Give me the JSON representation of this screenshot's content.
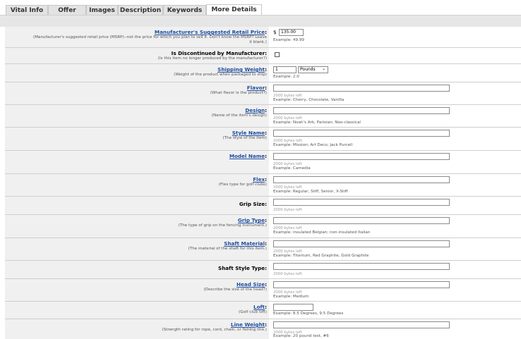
{
  "tabs": [
    "Vital Info",
    "Offer",
    "Images",
    "Description",
    "Keywords",
    "More Details"
  ],
  "msrp": {
    "label": "Manufacturer's Suggested Retail Price",
    "desc": "(Manufacturer's suggested retail price (MSRP)--not the price for which you plan to sell it. Don't know the MSRP? Leave it blank.)",
    "currency": "$",
    "value": "135.00",
    "example": "Example: 49.99"
  },
  "discontinued": {
    "label": "Is Discontinued by Manufacturer:",
    "desc": "(Is this item no longer produced by the manufacturer?)",
    "checked": false
  },
  "shipping_weight": {
    "label": "Shipping Weight",
    "desc": "(Weight of the product when packaged to ship)",
    "value": "1",
    "unit": "Pounds",
    "example": "Example: 2.0"
  },
  "fields": [
    {
      "label": "Flavor",
      "linked": true,
      "desc": "(What flavor is the product?)",
      "bytes": "2000 bytes left",
      "example": "Example: Cherry, Chocolate, Vanilla"
    },
    {
      "label": "Design",
      "linked": true,
      "desc": "(Name of the item's design)",
      "bytes": "2000 bytes left",
      "example": "Example: Noah's Ark; Parisian; Neo-classical"
    },
    {
      "label": "Style Name",
      "linked": true,
      "desc": "(The style of the item)",
      "bytes": "2000 bytes left",
      "example": "Example: Mission; Art Deco; Jack Purcell"
    },
    {
      "label": "Model Name",
      "linked": true,
      "desc": "",
      "bytes": "2000 bytes left",
      "example": "Example: Camedia"
    },
    {
      "label": "Flex",
      "linked": true,
      "desc": "(Flex type for golf clubs)",
      "bytes": "2000 bytes left",
      "example": "Example: Regular, Stiff, Senior, X-Stiff"
    },
    {
      "label": "Grip Size:",
      "linked": false,
      "desc": "",
      "bytes": "2000 bytes left",
      "example": ""
    },
    {
      "label": "Grip Type",
      "linked": true,
      "desc": "(The type of grip on the fencing instrument.)",
      "bytes": "2000 bytes left",
      "example": "Example: insulated Belgian; non-insulated Italian"
    },
    {
      "label": "Shaft Material",
      "linked": true,
      "desc": "(The material of the shaft for this item.)",
      "bytes": "2000 bytes left",
      "example": "Example: Titanium, Red Graphite, Gold Graphite"
    },
    {
      "label": "Shaft Style Type:",
      "linked": false,
      "desc": "",
      "bytes": "2000 bytes left",
      "example": ""
    },
    {
      "label": "Head Size",
      "linked": true,
      "desc": "(Describe the size of the head?)",
      "bytes": "2000 bytes left",
      "example": "Example: Medium"
    },
    {
      "label": "Loft",
      "linked": true,
      "desc": "(Golf club loft)",
      "bytes": "",
      "example": "Example: 8.5 Degrees, 9.5 Degrees"
    },
    {
      "label": "Line Weight",
      "linked": true,
      "desc": "(Strength rating for rope, cord, chain, or fishing line.)",
      "bytes": "2000 bytes left",
      "example": "Example: 20 pound test, #6"
    }
  ]
}
